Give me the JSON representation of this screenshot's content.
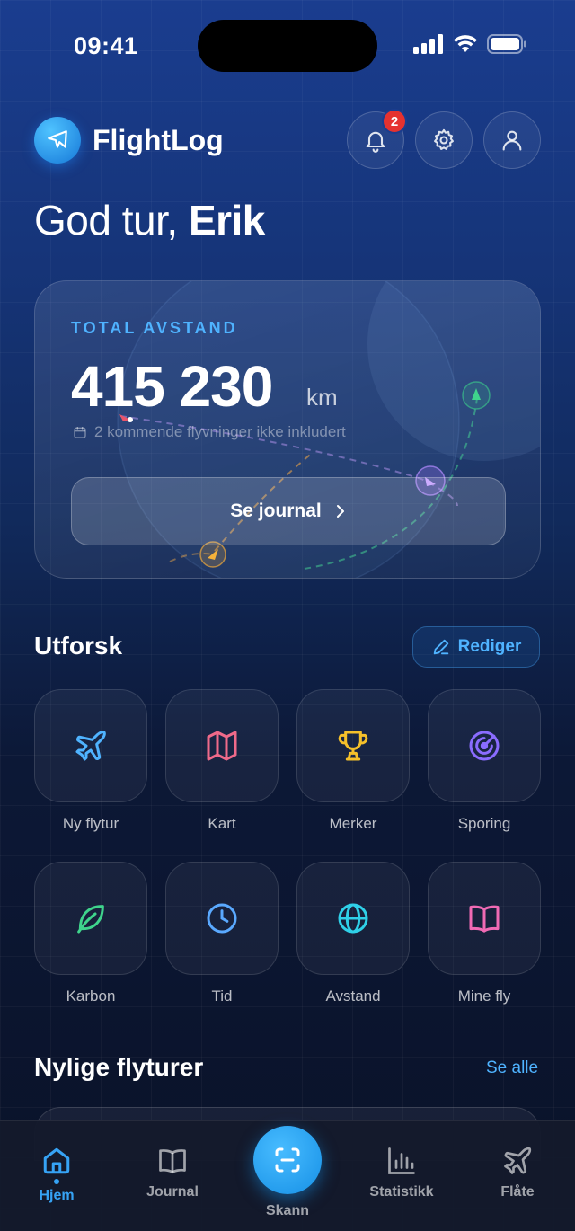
{
  "status_bar": {
    "time": "09:41"
  },
  "header": {
    "app_name": "FlightLog",
    "notification_count": "2"
  },
  "greeting": {
    "prefix": "God tur,",
    "name": "Erik"
  },
  "total_card": {
    "label": "TOTAL AVSTAND",
    "value": "415 230",
    "unit": "km",
    "note": "2 kommende flyvninger ikke inkludert",
    "button_label": "Se journal"
  },
  "explore": {
    "title": "Utforsk",
    "edit_label": "Rediger",
    "tiles": [
      {
        "label": "Ny flytur",
        "icon": "plane-icon",
        "color": "#4fb3ff"
      },
      {
        "label": "Kart",
        "icon": "map-icon",
        "color": "#f06a8a"
      },
      {
        "label": "Merker",
        "icon": "trophy-icon",
        "color": "#f5c02a"
      },
      {
        "label": "Sporing",
        "icon": "radar-icon",
        "color": "#8a6cff"
      },
      {
        "label": "Karbon",
        "icon": "leaf-icon",
        "color": "#3fd48c"
      },
      {
        "label": "Tid",
        "icon": "clock-icon",
        "color": "#5aa9ff"
      },
      {
        "label": "Avstand",
        "icon": "globe-icon",
        "color": "#2fd0e8"
      },
      {
        "label": "Mine fly",
        "icon": "book-icon",
        "color": "#f06ab4"
      }
    ]
  },
  "recent": {
    "title": "Nylige flyturer",
    "see_all_label": "Se alle"
  },
  "tabbar": {
    "tabs": [
      {
        "label": "Hjem",
        "icon": "home-icon",
        "active": true
      },
      {
        "label": "Journal",
        "icon": "book-icon"
      },
      {
        "label": "Skann",
        "icon": "scan-icon"
      },
      {
        "label": "Statistikk",
        "icon": "bar-chart-icon"
      },
      {
        "label": "Flåte",
        "icon": "plane-icon"
      }
    ]
  },
  "colors": {
    "accent": "#36a3f5",
    "badge": "#e5322f"
  }
}
